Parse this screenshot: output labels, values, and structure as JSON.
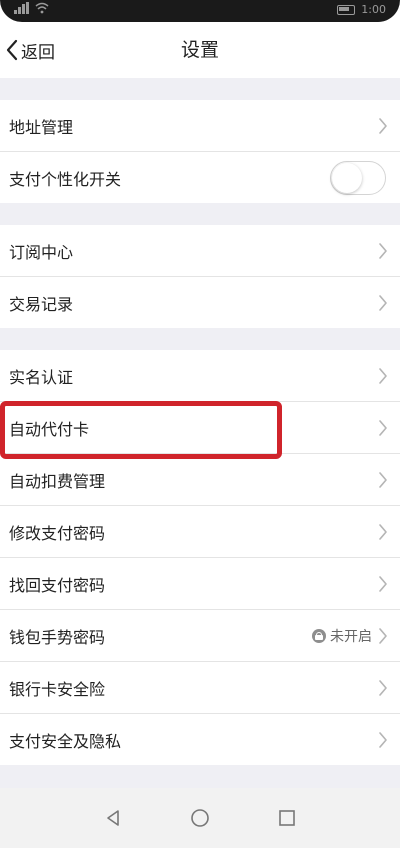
{
  "status_bar": {
    "time": "1:00"
  },
  "nav": {
    "back_label": "返回",
    "title": "设置"
  },
  "groups": [
    {
      "items": [
        {
          "label": "地址管理",
          "control": "chevron"
        },
        {
          "label": "支付个性化开关",
          "control": "toggle",
          "toggle_on": false
        }
      ]
    },
    {
      "items": [
        {
          "label": "订阅中心",
          "control": "chevron"
        },
        {
          "label": "交易记录",
          "control": "chevron"
        }
      ]
    },
    {
      "items": [
        {
          "label": "实名认证",
          "control": "chevron"
        },
        {
          "label": "自动代付卡",
          "control": "chevron",
          "highlighted": true
        },
        {
          "label": "自动扣费管理",
          "control": "chevron"
        },
        {
          "label": "修改支付密码",
          "control": "chevron"
        },
        {
          "label": "找回支付密码",
          "control": "chevron"
        },
        {
          "label": "钱包手势密码",
          "control": "chevron",
          "status": "未开启"
        },
        {
          "label": "银行卡安全险",
          "control": "chevron"
        },
        {
          "label": "支付安全及隐私",
          "control": "chevron"
        }
      ]
    }
  ],
  "icons": {
    "back": "chevron-left-icon",
    "row_chevron": "chevron-right-icon",
    "status_lock": "lock-icon",
    "nav_back": "triangle-back-icon",
    "nav_home": "circle-home-icon",
    "nav_recent": "square-recent-icon"
  },
  "colors": {
    "highlight": "#d0242b",
    "background": "#efeff4"
  }
}
